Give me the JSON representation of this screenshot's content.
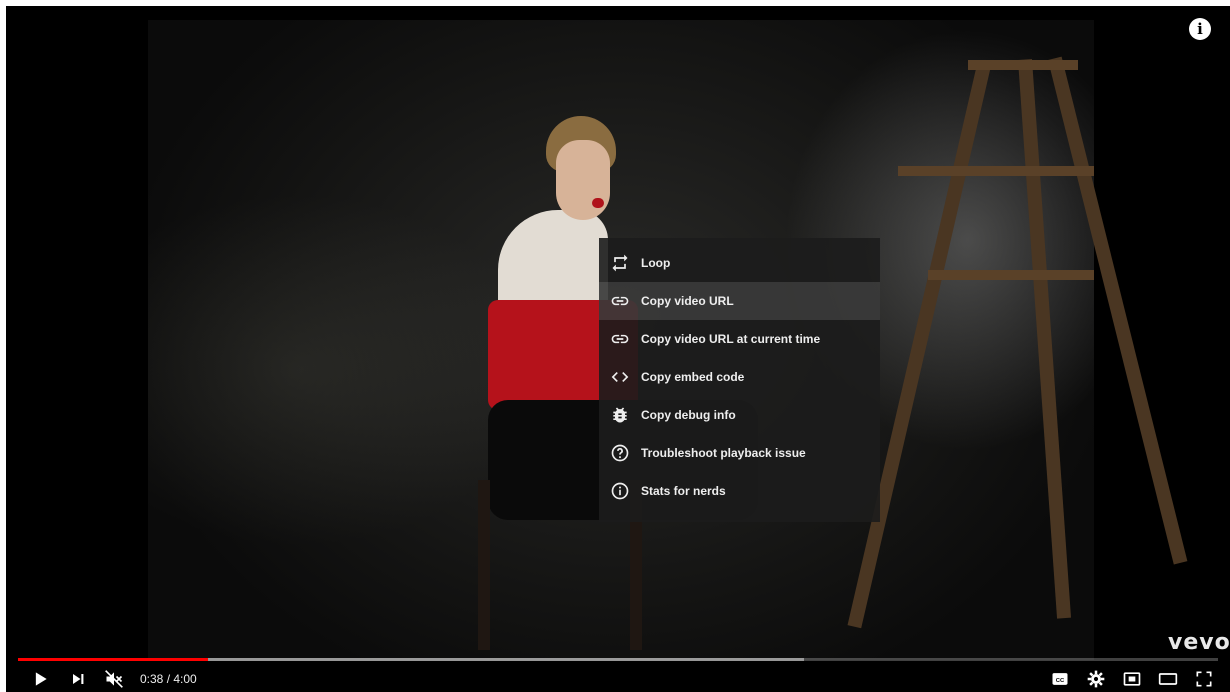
{
  "player": {
    "info_icon": "info-icon",
    "brand": "vevo"
  },
  "context_menu": {
    "items": [
      {
        "label": "Loop",
        "icon": "loop-icon"
      },
      {
        "label": "Copy video URL",
        "icon": "link-icon"
      },
      {
        "label": "Copy video URL at current time",
        "icon": "link-icon"
      },
      {
        "label": "Copy embed code",
        "icon": "code-icon"
      },
      {
        "label": "Copy debug info",
        "icon": "bug-icon"
      },
      {
        "label": "Troubleshoot playback issue",
        "icon": "help-icon"
      },
      {
        "label": "Stats for nerds",
        "icon": "info-circle-icon"
      }
    ],
    "highlighted_index": 1
  },
  "progress": {
    "current": "0:38",
    "duration": "4:00",
    "played_fraction": 0.158,
    "buffered_fraction": 0.655
  },
  "controls": {
    "time_text": "0:38 / 4:00",
    "left": [
      "play-icon",
      "next-icon",
      "mute-icon"
    ],
    "right": [
      "subtitles-icon",
      "settings-icon",
      "miniplayer-icon",
      "theater-icon",
      "fullscreen-icon"
    ]
  },
  "colors": {
    "progress_played": "#ff0000",
    "menu_bg": "#1c1c1c"
  }
}
